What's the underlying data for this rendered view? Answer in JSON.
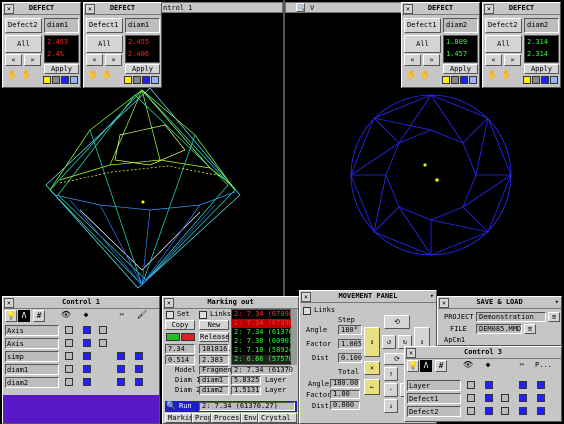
{
  "viewports": {
    "left_title": "ntrol 1",
    "right_title": "V"
  },
  "defect_panels": [
    {
      "title": "DEFECT",
      "label": "Defect2",
      "field": "diam1",
      "all": "All",
      "apply": "Apply",
      "v1": "2.453",
      "v2": "2.4%",
      "vcolor": "#ff2020"
    },
    {
      "title": "DEFECT",
      "label": "Defect1",
      "field": "diam1",
      "all": "All",
      "apply": "Apply",
      "v1": "2.455",
      "v2": "2.406",
      "vcolor": "#ff2020"
    },
    {
      "title": "DEFECT",
      "label": "Defect1",
      "field": "diam2",
      "all": "All",
      "apply": "Apply",
      "v1": "1.809",
      "v2": "1.457",
      "vcolor": "#30ff30"
    },
    {
      "title": "DEFECT",
      "label": "Defect2",
      "field": "diam2",
      "all": "All",
      "apply": "Apply",
      "v1": "2.314",
      "v2": "2.314",
      "vcolor": "#30ff30"
    }
  ],
  "control1": {
    "title": "Control 1",
    "rows": [
      "Axis",
      "Axis",
      "simp",
      "diam1",
      "diam2"
    ]
  },
  "marking": {
    "title": "Marking out",
    "set": "Set",
    "links": "Links",
    "copy": "Copy",
    "new": "New",
    "release": "Release",
    "v1": "7.34",
    "v2": "101816.4",
    "v3": "0.514",
    "v4": "2.383",
    "list": [
      "2: 7.34 (67098",
      "2: 7.34 (67098",
      "2: 7.34 (61370",
      "2: 7.38 (60907",
      "2: 7.18 (58924",
      "2: 6.66 (57578"
    ],
    "list_colors": [
      "#ff3030",
      "#ff3030",
      "#30ff30",
      "#30ff30",
      "#30ff30",
      "#30ff30"
    ],
    "model_label": "Model",
    "model_val": "Fragment",
    "model_right": "2: 7.34 (61370",
    "d1_label": "Diam 1",
    "d1_name": "diam1",
    "d1_val": "5.8325",
    "d1_right": "Layer",
    "d2_label": "Diam 2",
    "d2_name": "diam2",
    "d2_val": "1.5131",
    "d2_right": "Layer",
    "run": "Run",
    "run_val": "2: 7.34 (61370.27)",
    "tabs": [
      "Marking",
      "Prog",
      "Process",
      "Env",
      "Crystal"
    ]
  },
  "movement": {
    "title": "MOVEMENT PANEL",
    "links": "Links",
    "step": "Step",
    "angle_label": "Angle",
    "angle_val": "180°",
    "factor_label": "Factor",
    "factor_val": "1.005",
    "dist_label": "Dist",
    "dist_val": "0.100",
    "total": "Total",
    "t_angle": "180.00",
    "t_factor": "1.00",
    "t_dist": "0.000"
  },
  "saveload": {
    "title": "SAVE & LOAD",
    "project_label": "PROJECT",
    "project_val": "Demonstration",
    "file_label": "FILE",
    "file_val": "DEM085.MMD",
    "extra": "ApCm1"
  },
  "control3": {
    "title": "Control 3",
    "header_p": "P...",
    "rows": [
      "Layer",
      "Defect1",
      "Defect2"
    ]
  }
}
